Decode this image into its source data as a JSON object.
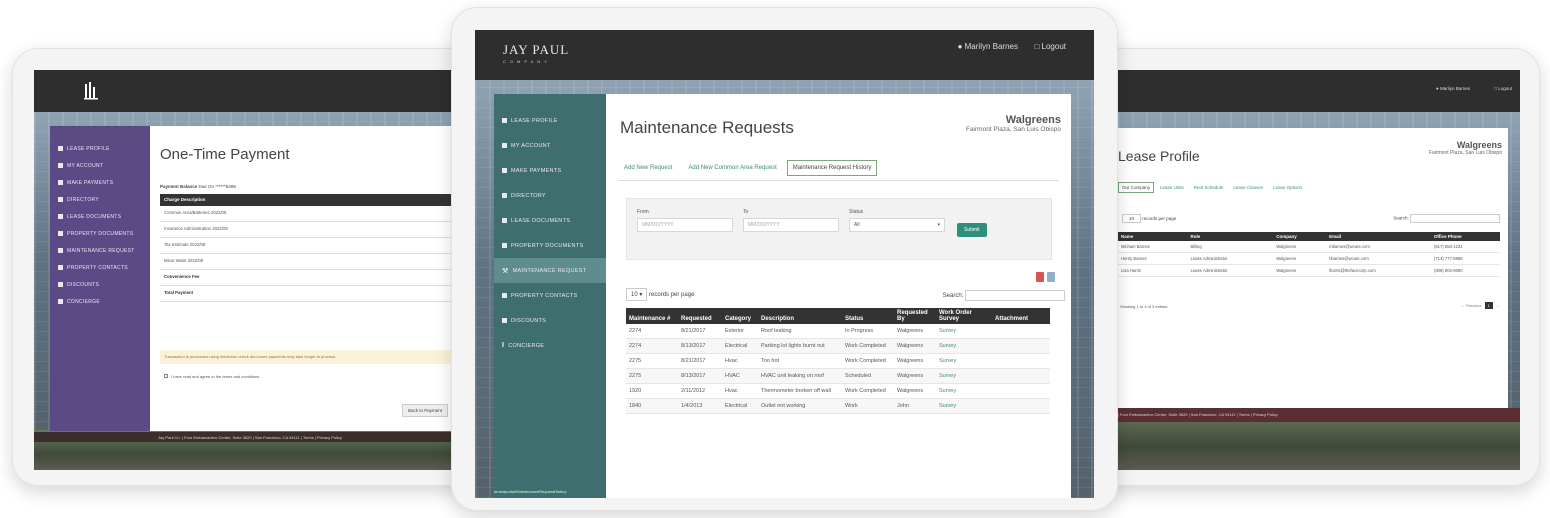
{
  "left": {
    "title": "One-Time Payment",
    "sidebar": [
      "Lease Profile",
      "My Account",
      "Make Payments",
      "Directory",
      "Lease Documents",
      "Property Documents",
      "Maintenance Request",
      "Property Contacts",
      "Discounts",
      "Concierge"
    ],
    "payment_balance_label": "Payment Balance",
    "payment_balance_value": "Due On ******6495",
    "header": "Charge Description",
    "rows": [
      "Common Area/Batteries 2022/08",
      "Insurance Administration 2022/08",
      "Tax Estimate 2022/08",
      "Minor Maint 2022/08",
      "Convenience Fee",
      "Total Payment"
    ],
    "note": "Transaction is processed using electronic check and some payments may take longer to process.",
    "agree": "I have read and agree to the terms and conditions.",
    "back_button": "Back to Payment",
    "footer": "Jay Paul Co. | Four Embarcadero Center, Suite 3620 | San Francisco, CA 94111 | Terms | Privacy Policy"
  },
  "center": {
    "logo_main": "JAY PAUL",
    "logo_sub": "COMPANY",
    "user": "Marilyn Barnes",
    "logout": "Logout",
    "page_title": "Maintenance Requests",
    "tenant_name": "Walgreens",
    "tenant_loc": "Fairmont Plaza, San Luis Obispo",
    "sidebar": [
      "Lease Profile",
      "My Account",
      "Make Payments",
      "Directory",
      "Lease Documents",
      "Property Documents",
      "Maintenance Request",
      "Property Contacts",
      "Discounts",
      "Concierge"
    ],
    "tabs": [
      "Add New Request",
      "Add New Common Area Request",
      "Maintenance Request History"
    ],
    "from_label": "From",
    "from_placeholder": "MM/DD/YYYY",
    "to_label": "To",
    "to_placeholder": "MM/DD/YYYY",
    "status_label": "Status",
    "status_value": "All",
    "submit": "Submit",
    "per_page_value": "10",
    "per_page_label": "records per page",
    "search_label": "Search:",
    "columns": [
      "Maintenance #",
      "Requested",
      "Category",
      "Description",
      "Status",
      "Requested By",
      "Work Order Survey",
      "Attachment"
    ],
    "rows": [
      [
        "2274",
        "8/21/2017",
        "Exterior",
        "Roof leaking",
        "In Progress",
        "Walgreens",
        "Survey",
        ""
      ],
      [
        "2274",
        "8/13/2017",
        "Electrical",
        "Parking lot lights burnt out",
        "Work Completed",
        "Walgreens",
        "Survey",
        ""
      ],
      [
        "2275",
        "8/21/2017",
        "Hvac",
        "Too hot",
        "Work Completed",
        "Walgreens",
        "Survey",
        ""
      ],
      [
        "2275",
        "8/13/2017",
        "HVAC",
        "HVAC unit leaking on roof",
        "Scheduled",
        "Walgreens",
        "Survey",
        ""
      ],
      [
        "1920",
        "2/11/2012",
        "Hvac",
        "Thermometer broken off wall",
        "Work Completed",
        "Walgreens",
        "Survey",
        ""
      ],
      [
        "1840",
        "1/4/2013",
        "Electrical",
        "Outlet not working",
        "Work",
        "John",
        "Survey",
        ""
      ]
    ],
    "status_url": "tenantportal/MaintenanceRequestHistory"
  },
  "right": {
    "user": "Marilyn Barnes",
    "logout": "Logout",
    "title": "Lease Profile",
    "tenant_name": "Walgreens",
    "tenant_loc": "Fairmont Plaza, San Luis Obispo",
    "tabs": [
      "Our Company",
      "Lease Units",
      "Rent Schedule",
      "Lease Clauses",
      "Lease Options"
    ],
    "per_page_value": "10",
    "per_page_label": "records per page",
    "search_label": "Search:",
    "columns": [
      "Name",
      "Role",
      "Company",
      "Email",
      "Office Phone"
    ],
    "rows": [
      [
        "Michael Barnes",
        "Billing",
        "Walgreens",
        "mbarnes@wcare.com",
        "(817) 553-1234"
      ],
      [
        "Henry Barnes",
        "Lease Administrator",
        "Walgreens",
        "hbarnes@wcare.com",
        "(713) 777-8888"
      ],
      [
        "Lisa Harris",
        "Lease Administrator",
        "Walgreens",
        "lharris@thefacecorp.com",
        "(808) 904-9090"
      ]
    ],
    "showing": "Showing 1 to 3 of 3 entries",
    "prev": "← Previous",
    "page": "1",
    "next": "→",
    "footer": "Jay Paul Co. | Four Embarcadero Center, Suite 3620 | San Francisco, CA 94111 | Terms | Privacy Policy"
  }
}
